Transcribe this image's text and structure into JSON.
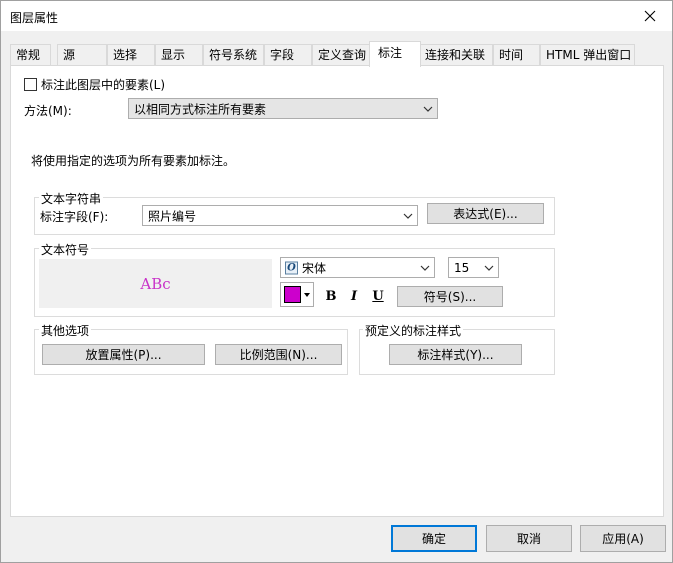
{
  "window": {
    "title": "图层属性"
  },
  "tabs": [
    {
      "label": "常规"
    },
    {
      "label": "源"
    },
    {
      "label": "选择"
    },
    {
      "label": "显示"
    },
    {
      "label": "符号系统"
    },
    {
      "label": "字段"
    },
    {
      "label": "定义查询"
    },
    {
      "label": "标注",
      "active": true
    },
    {
      "label": "连接和关联"
    },
    {
      "label": "时间"
    },
    {
      "label": "HTML 弹出窗口"
    }
  ],
  "label_layer": {
    "checkbox_label": "标注此图层中的要素(L)",
    "checked": false
  },
  "method": {
    "label": "方法(M):",
    "value": "以相同方式标注所有要素"
  },
  "info_text": "将使用指定的选项为所有要素加标注。",
  "text_string": {
    "group_title": "文本字符串",
    "field_label": "标注字段(F):",
    "field_value": "照片编号",
    "expression_button": "表达式(E)..."
  },
  "text_symbol": {
    "group_title": "文本符号",
    "preview_text": "ABc",
    "font_name": "宋体",
    "font_size": "15",
    "color": "#cc00cc",
    "bold_label": "B",
    "italic_label": "I",
    "underline_label": "U",
    "symbol_button": "符号(S)..."
  },
  "other_options": {
    "group_title": "其他选项",
    "placement_button": "放置属性(P)...",
    "scale_button": "比例范围(N)..."
  },
  "predefined_style": {
    "group_title": "预定义的标注样式",
    "style_button": "标注样式(Y)..."
  },
  "footer": {
    "ok_button": "确定",
    "cancel_button": "取消",
    "apply_button": "应用(A)"
  }
}
